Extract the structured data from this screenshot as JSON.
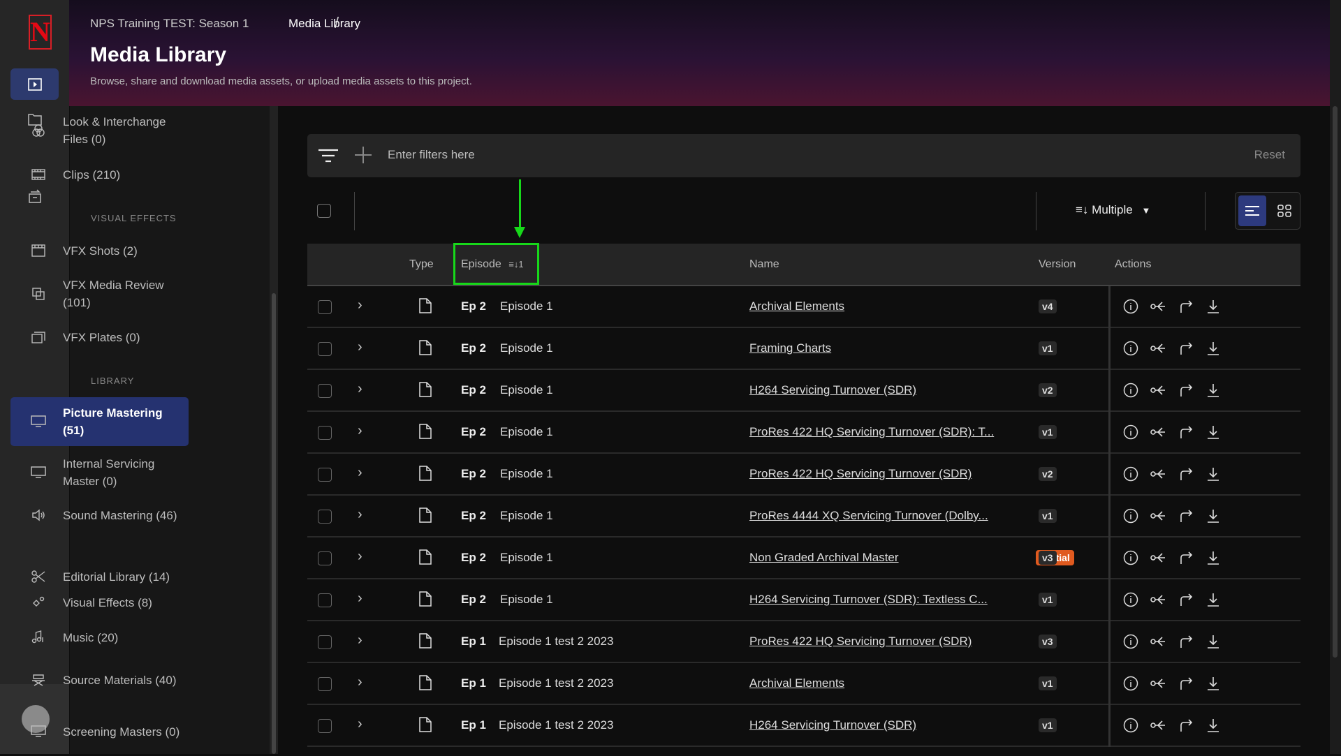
{
  "app": {
    "logo": "N",
    "accent": "#2d3a7e",
    "brand": "#e50914"
  },
  "breadcrumb": {
    "project": "NPS Training TEST: Season 1",
    "separator": "/",
    "current": "Media Library"
  },
  "header": {
    "title": "Media Library",
    "subtitle": "Browse, share and download media assets, or upload media assets to this project."
  },
  "sidebar": {
    "items_top": [
      {
        "label": "Look & Interchange Files (0)",
        "icon": "circles-icon"
      },
      {
        "label": "Clips (210)",
        "icon": "film-icon"
      }
    ],
    "section_vfx": "VISUAL EFFECTS",
    "items_vfx": [
      {
        "label": "VFX Shots (2)",
        "icon": "clapper-icon"
      },
      {
        "label": "VFX Media Review (101)",
        "icon": "review-icon"
      },
      {
        "label": "VFX Plates (0)",
        "icon": "plates-icon"
      }
    ],
    "section_library": "LIBRARY",
    "items_library": [
      {
        "label": "Picture Mastering (51)",
        "icon": "monitor-icon",
        "active": true
      },
      {
        "label": "Internal Servicing Master (0)",
        "icon": "monitor-icon"
      },
      {
        "label": "Sound Mastering (46)",
        "icon": "speaker-icon"
      },
      {
        "label": "Editorial Library (14)",
        "icon": "scissors-icon"
      },
      {
        "label": "Visual Effects (8)",
        "icon": "sparkle-icon"
      },
      {
        "label": "Music (20)",
        "icon": "music-icon"
      },
      {
        "label": "Source Materials (40)",
        "icon": "chair-icon"
      },
      {
        "label": "Screening Masters (0)",
        "icon": "monitor-icon"
      }
    ]
  },
  "filter": {
    "placeholder": "Enter filters here",
    "reset": "Reset"
  },
  "toolbar": {
    "sort_label": "Multiple",
    "sort_icon": "sort-desc-icon",
    "view": "list"
  },
  "table": {
    "columns": {
      "type": "Type",
      "episode": "Episode",
      "episode_sort": "1",
      "name": "Name",
      "version": "Version",
      "actions": "Actions"
    },
    "rows": [
      {
        "ep": "Ep 2",
        "episode": "Episode 1",
        "name": "Archival Elements",
        "version": "v4"
      },
      {
        "ep": "Ep 2",
        "episode": "Episode 1",
        "name": "Framing Charts",
        "version": "v1"
      },
      {
        "ep": "Ep 2",
        "episode": "Episode 1",
        "name": "H264 Servicing Turnover (SDR)",
        "version": "v2"
      },
      {
        "ep": "Ep 2",
        "episode": "Episode 1",
        "name": "ProRes 422 HQ Servicing Turnover (SDR): T...",
        "version": "v1"
      },
      {
        "ep": "Ep 2",
        "episode": "Episode 1",
        "name": "ProRes 422 HQ Servicing Turnover (SDR)",
        "version": "v2"
      },
      {
        "ep": "Ep 2",
        "episode": "Episode 1",
        "name": "ProRes 4444 XQ Servicing Turnover (Dolby...",
        "version": "v1"
      },
      {
        "ep": "Ep 2",
        "episode": "Episode 1",
        "name": "Non Graded Archival Master",
        "version": "v3",
        "badge": "Partial"
      },
      {
        "ep": "Ep 2",
        "episode": "Episode 1",
        "name": "H264 Servicing Turnover (SDR): Textless C...",
        "version": "v1"
      },
      {
        "ep": "Ep 1",
        "episode": "Episode 1 test 2 2023",
        "name": "ProRes 422 HQ Servicing Turnover (SDR)",
        "version": "v3"
      },
      {
        "ep": "Ep 1",
        "episode": "Episode 1 test 2 2023",
        "name": "Archival Elements",
        "version": "v1"
      },
      {
        "ep": "Ep 1",
        "episode": "Episode 1 test 2 2023",
        "name": "H264 Servicing Turnover (SDR)",
        "version": "v1"
      }
    ],
    "badge_color": "#e05a1f"
  },
  "annotation": {
    "color": "#17d81a"
  }
}
